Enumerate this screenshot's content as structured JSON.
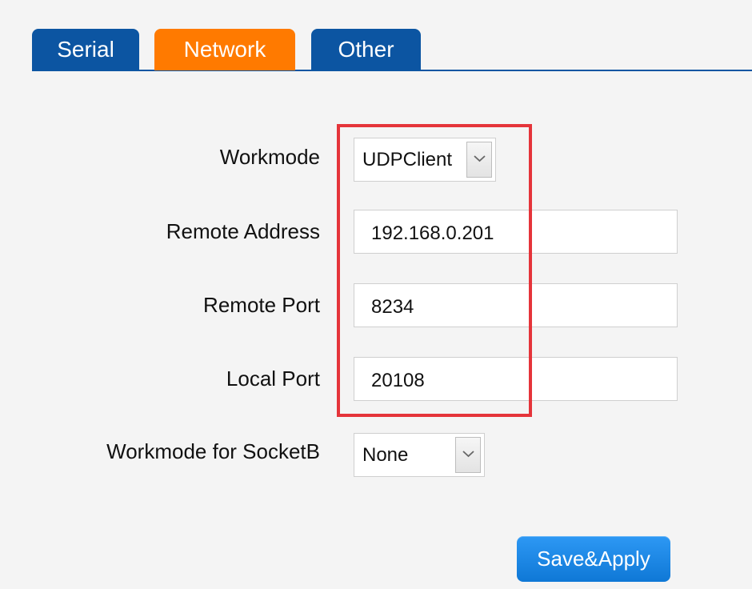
{
  "tabs": [
    {
      "label": "Serial",
      "active": false
    },
    {
      "label": "Network",
      "active": true
    },
    {
      "label": "Other",
      "active": false
    }
  ],
  "form": {
    "workmode": {
      "label": "Workmode",
      "value": "UDPClient"
    },
    "remote_address": {
      "label": "Remote Address",
      "value": "192.168.0.201"
    },
    "remote_port": {
      "label": "Remote Port",
      "value": "8234"
    },
    "local_port": {
      "label": "Local Port",
      "value": "20108"
    },
    "workmode_socketb": {
      "label": "Workmode for SocketB",
      "value": "None"
    }
  },
  "actions": {
    "save_apply_label": "Save&Apply"
  },
  "icons": {
    "dropdown": "chevron-down-icon"
  },
  "colors": {
    "tab_active": "#ff7a00",
    "tab_inactive": "#0c55a2",
    "highlight": "#e5343a",
    "button": "#1783df"
  }
}
